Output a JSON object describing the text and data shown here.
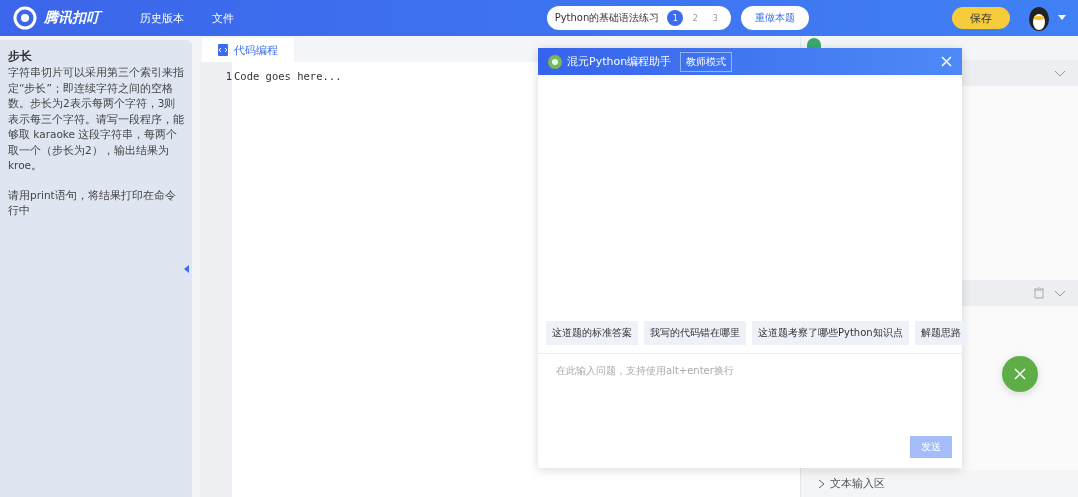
{
  "header": {
    "logo": "腾讯扣叮",
    "menu": [
      "历史版本",
      "文件"
    ],
    "exercise": {
      "title": "Python的基础语法练习",
      "steps": [
        {
          "label": "1",
          "selected": true
        },
        {
          "label": "2",
          "selected": false
        },
        {
          "label": "3",
          "selected": false
        }
      ]
    },
    "redo": "重做本题",
    "save": "保存"
  },
  "task": {
    "title": "步长",
    "paragraphs": [
      "字符串切片可以采用第三个索引来指定“步长”；即连续字符之间的空格数。步长为2表示每两个字符，3则表示每三个字符。请写一段程序，能够取 karaoke 这段字符串，每两个取一个（步长为2），输出结果为 kroe。",
      "请用print语句，将结果打印在命令行中"
    ]
  },
  "editor": {
    "tab": "代码编程",
    "lines": [
      {
        "number": "1",
        "code": "Code goes here..."
      }
    ]
  },
  "right": {
    "input_section": "文本输入区"
  },
  "assistant": {
    "title": "混元Python编程助手",
    "mode": "教师模式",
    "suggestions": [
      "这道题的标准答案",
      "我写的代码错在哪里",
      "这道题考察了哪些Python知识点",
      "解题思路"
    ],
    "placeholder": "在此输入问题，支持使用alt+enter换行",
    "send": "发送"
  }
}
